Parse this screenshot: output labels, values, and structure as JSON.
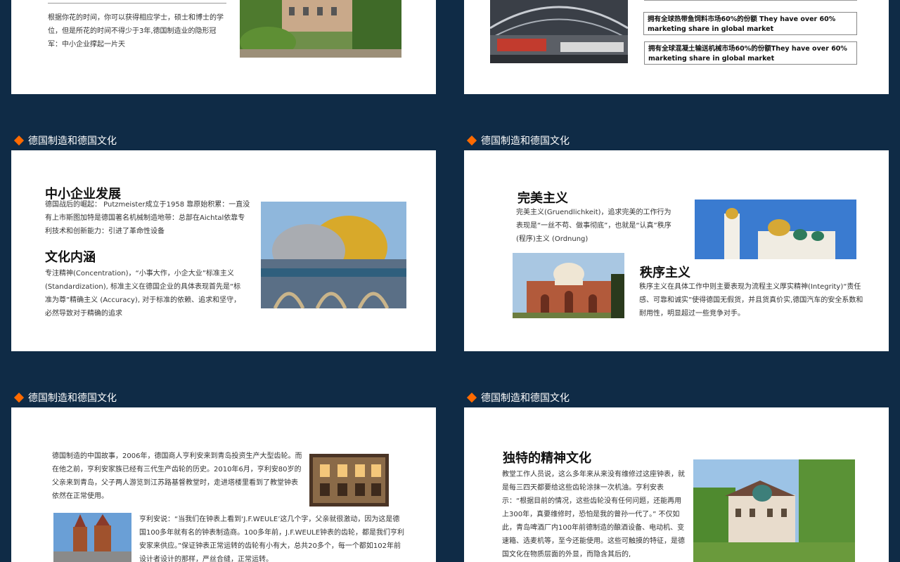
{
  "header_title": "德国制造和德国文化",
  "slide1": {
    "text": "根据你花的时间，你可以获得相应学士，硕士和博士的学位，但是所花的时间不得少于3年,德国制造业的隐形冠军：中小企业撑起一片天"
  },
  "slide2": {
    "box1": "拥有全球热带鱼饲料市场60%的份额 They have over 60% marketing share in global market",
    "box2": "拥有全球混凝土输送机械市场60%的份额They have over 60% marketing share in global market"
  },
  "slide3": {
    "title1": "中小企业发展",
    "text1": "德国战后的崛起： Putzmeister成立于1958 靠原始积累：一直没有上市斯图加特是德国著名机械制造地带：总部在Aichtal依靠专利技术和创新能力：引进了革命性设备",
    "title2": "文化内涵",
    "text2": "专注精神(Concentration)，“小事大作，小企大业”标准主义(Standardization), 标准主义在德国企业的具体表现首先是“标准为尊”精确主义 (Accuracy), 对于标准的依赖、追求和坚守，必然导致对于精确的追求"
  },
  "slide4": {
    "title1": "完美主义",
    "text1": "完美主义(Gruendlichkeit)，追求完美的工作行为表现是“一丝不苟、做事彻底”，也就是“认真”秩序(程序)主义 (Ordnung)",
    "title2": "秩序主义",
    "text2": "秩序主义在具体工作中则主要表现为流程主义厚实精神(Integrity)“责任感、可靠和诚实”使得德国无假货，并且货真价实,德国汽车的安全系数和耐用性，明显超过一些竞争对手。"
  },
  "slide5": {
    "text1": "德国制造的中国故事，2006年，德国商人亨利安来到青岛投资生产大型齿轮。而在他之前，亨利安家族已经有三代生产齿轮的历史。2010年6月，亨利安80岁的父亲来到青岛，父子两人游览到江苏路基督教堂时，走进塔楼里看到了教堂钟表依然在正常使用。",
    "text2": "亨利安说：“当我们在钟表上看到‘J.F.WEULE’这几个字，父亲就很激动，因为这是德国100多年就有名的钟表制造商。100多年前，J.F.WEULE钟表的齿轮，都是我们亨利安家来供应。”保证钟表正常运转的齿轮有小有大，总共20多个，每一个都如102年前设计者设计的那样，严丝合缝，正常运转。"
  },
  "slide6": {
    "title": "独特的精神文化",
    "text": "教堂工作人员说，这么多年来从来没有维修过这座钟表，就是每三四天都要给这些齿轮涂抹一次机油。亨利安表示：“根据目前的情况，这些齿轮没有任何问题，还能再用上300年，真要维修时，恐怕是我的曾孙一代了。” 不仅如此，青岛啤酒厂内100年前德制造的酿酒设备、电动机、变速箱、选麦机等，至今还能使用。这些可触摸的特征，是德国文化在物质层面的外显，而隐含其后的,"
  }
}
